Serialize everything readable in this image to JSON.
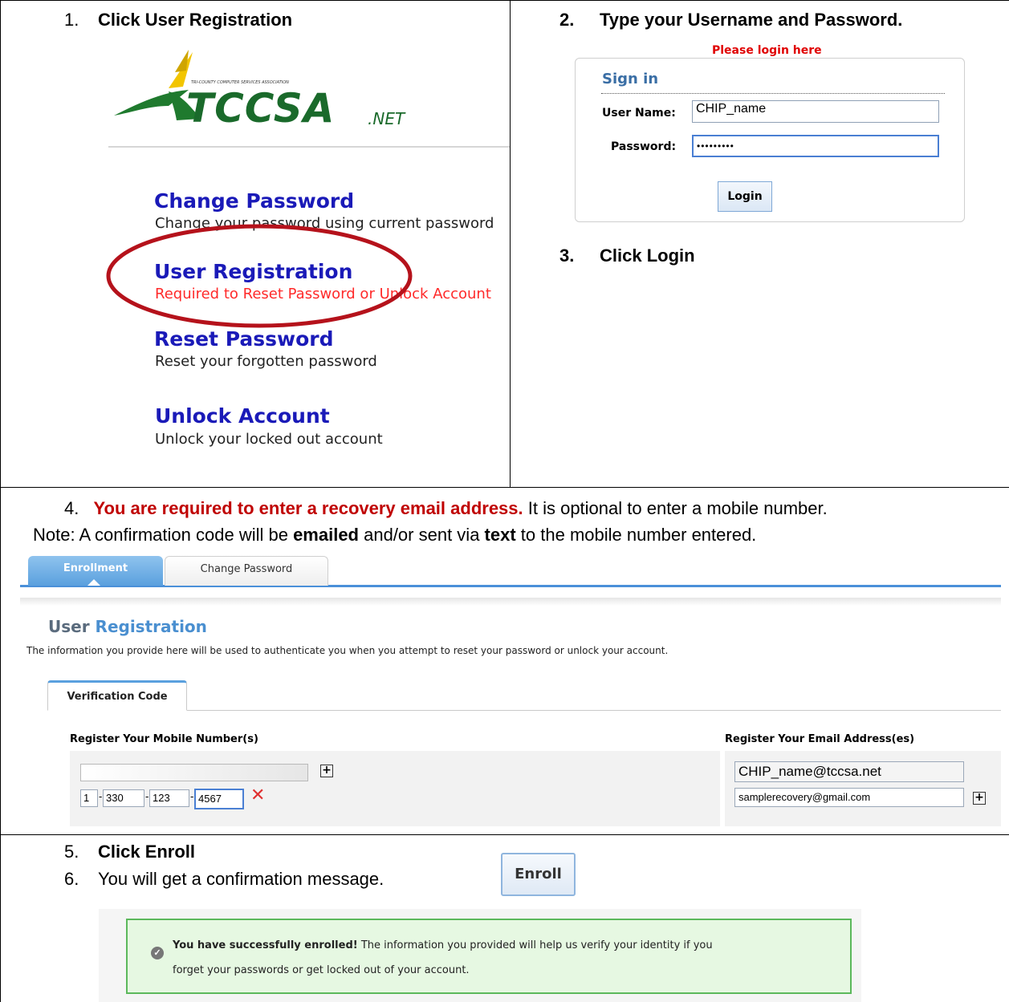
{
  "steps": {
    "s1": {
      "num": "1.",
      "text": "Click User Registration"
    },
    "s2": {
      "num": "2.",
      "text": "Type your Username and Password."
    },
    "s3": {
      "num": "3.",
      "text": "Click Login"
    },
    "s4": {
      "num": "4.",
      "red": "You are required to enter a recovery email address.",
      "rest": " It is optional to enter a mobile number."
    },
    "note": {
      "prefix": "Note: A confirmation code will be ",
      "b1": "emailed",
      "mid": " and/or sent via ",
      "b2": "text",
      "suffix": " to the mobile number entered."
    },
    "s5": {
      "num": "5.",
      "text": "Click Enroll"
    },
    "s6": {
      "num": "6.",
      "text": "You will get a confirmation message."
    }
  },
  "logo": {
    "small_caption": "TRI-COUNTY COMPUTER SERVICES ASSOCIATION",
    "main": "TCCSA",
    "suffix": ".NET"
  },
  "menu": {
    "change_password": {
      "title": "Change Password",
      "desc": "Change your password using current password"
    },
    "user_registration": {
      "title": "User Registration",
      "desc": "Required to Reset Password or Unlock Account"
    },
    "reset_password": {
      "title": "Reset Password",
      "desc": "Reset your forgotten password"
    },
    "unlock_account": {
      "title": "Unlock Account",
      "desc": "Unlock your locked out account"
    }
  },
  "login": {
    "banner": "Please login here",
    "heading": "Sign in",
    "username_label": "User Name:",
    "username_value": "CHIP_name",
    "password_label": "Password:",
    "password_value": "•••••••••",
    "login_button": "Login"
  },
  "enroll_ui": {
    "tabs": [
      "Enrollment",
      "Change Password"
    ],
    "title_part1": "User ",
    "title_part2": "Registration",
    "description": "The information you provide here will be used to authenticate you when you attempt to reset your password or unlock your account.",
    "subtab": "Verification Code",
    "mobile_heading": "Register Your Mobile Number(s)",
    "email_heading": "Register Your Email Address(es)",
    "phone": {
      "country": "1",
      "area": "330",
      "prefix": "123",
      "line": "4567"
    },
    "email1": "CHIP_name@tccsa.net",
    "email2": "samplerecovery@gmail.com"
  },
  "enroll_button": "Enroll",
  "confirmation": {
    "bold": "You have successfully enrolled!",
    "text1": " The information you provided will help us verify your identity if you",
    "text2": "forget your passwords or get locked out of your account."
  },
  "colors": {
    "link_blue": "#1a1ab8",
    "alert_red": "#c00000",
    "success_green": "#e6f8e2",
    "success_border": "#5cb85c",
    "oval_red": "#b5121b"
  }
}
